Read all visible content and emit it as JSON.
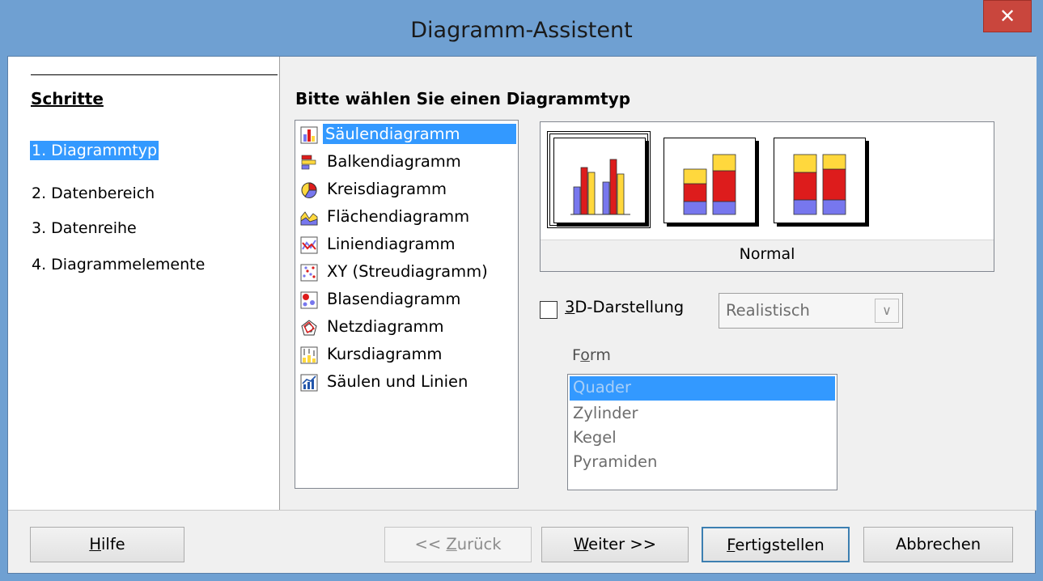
{
  "window": {
    "title": "Diagramm-Assistent",
    "close_glyph": "✕"
  },
  "steps": {
    "heading": "Schritte",
    "items": [
      "1. Diagrammtyp",
      "2. Datenbereich",
      "3. Datenreihe",
      "4. Diagrammelemente"
    ],
    "active_index": 0
  },
  "chart_types": {
    "heading": "Bitte wählen Sie einen Diagrammtyp",
    "items": [
      {
        "label": "Säulendiagramm",
        "icon": "column-chart-icon"
      },
      {
        "label": "Balkendiagramm",
        "icon": "bar-chart-icon"
      },
      {
        "label": "Kreisdiagramm",
        "icon": "pie-chart-icon"
      },
      {
        "label": "Flächendiagramm",
        "icon": "area-chart-icon"
      },
      {
        "label": "Liniendiagramm",
        "icon": "line-chart-icon"
      },
      {
        "label": "XY (Streudiagramm)",
        "icon": "scatter-chart-icon"
      },
      {
        "label": "Blasendiagramm",
        "icon": "bubble-chart-icon"
      },
      {
        "label": "Netzdiagramm",
        "icon": "net-chart-icon"
      },
      {
        "label": "Kursdiagramm",
        "icon": "stock-chart-icon"
      },
      {
        "label": "Säulen und Linien",
        "icon": "column-line-chart-icon"
      }
    ],
    "selected_index": 0
  },
  "preview": {
    "label": "Normal",
    "variants": [
      "normal-column-icon",
      "stacked-column-icon",
      "percent-stacked-column-icon"
    ],
    "selected_index": 0
  },
  "three_d": {
    "label_prefix": "",
    "label_mnemonic": "3",
    "label_rest": "D-Darstellung",
    "checked": false
  },
  "style_dropdown": {
    "value": "Realistisch",
    "arrow": "∨"
  },
  "form": {
    "label_prefix": "F",
    "label_mnemonic": "o",
    "label_rest": "rm",
    "options": [
      "Quader",
      "Zylinder",
      "Kegel",
      "Pyramiden"
    ],
    "selected_index": 0
  },
  "buttons": {
    "help": {
      "mnemonic": "H",
      "rest": "ilfe"
    },
    "back": {
      "prefix": "<< ",
      "mnemonic": "Z",
      "rest": "urück"
    },
    "next": {
      "mnemonic": "W",
      "rest": "eiter >>"
    },
    "finish": {
      "mnemonic": "F",
      "rest": "ertigstellen"
    },
    "cancel": {
      "label": "Abbrechen"
    }
  },
  "colors": {
    "accent": "#3399ff",
    "title_bg": "#6fa0d2",
    "close_bg": "#c9463d",
    "bar_blue": "#7777ee",
    "bar_red": "#dd1c1c",
    "bar_yellow": "#ffd83d"
  }
}
